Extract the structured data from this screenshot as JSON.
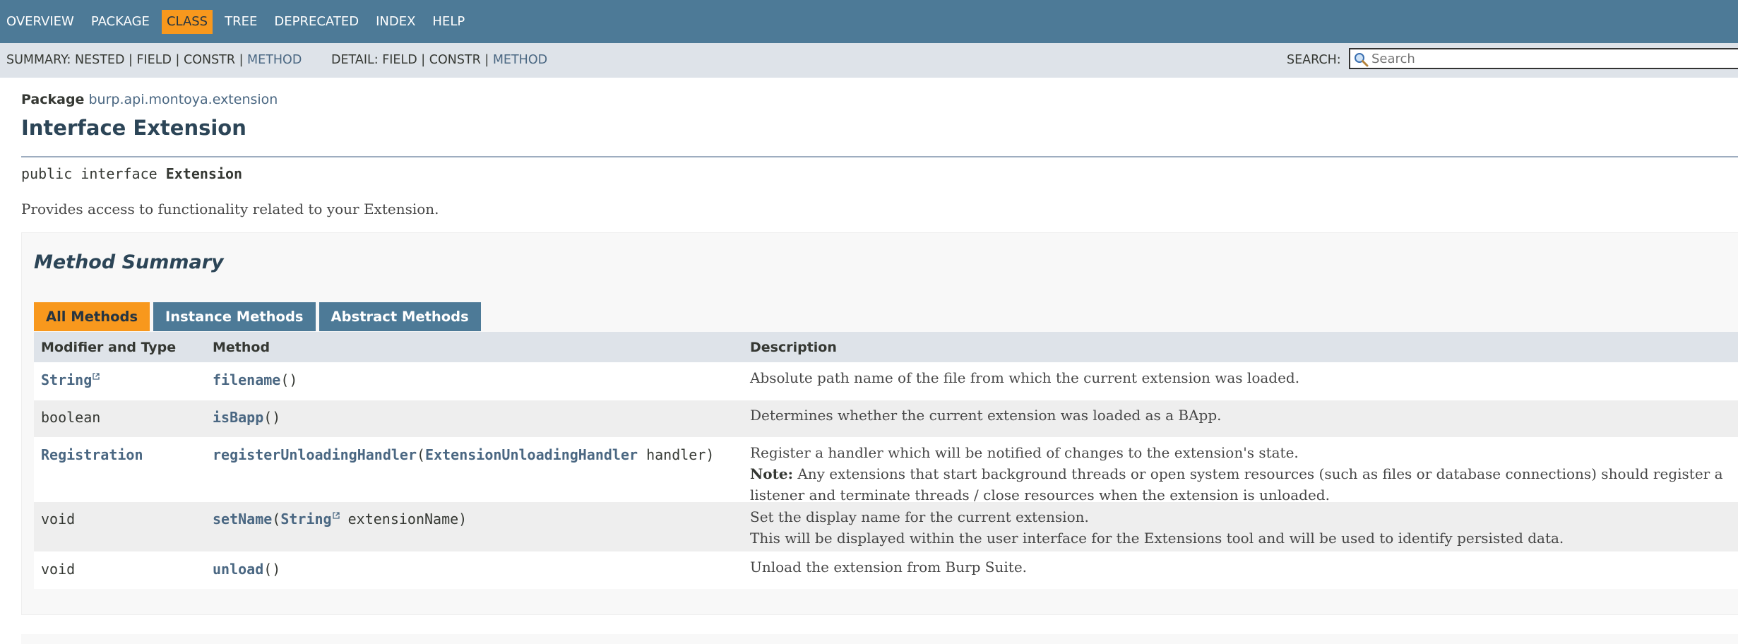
{
  "topnav": {
    "items": [
      {
        "label": "OVERVIEW",
        "active": false
      },
      {
        "label": "PACKAGE",
        "active": false
      },
      {
        "label": "CLASS",
        "active": true
      },
      {
        "label": "TREE",
        "active": false
      },
      {
        "label": "DEPRECATED",
        "active": false
      },
      {
        "label": "INDEX",
        "active": false
      },
      {
        "label": "HELP",
        "active": false
      }
    ]
  },
  "subnav": {
    "summary_prefix": "SUMMARY: NESTED | FIELD | CONSTR | ",
    "summary_method_link": "METHOD",
    "detail_prefix": "DETAIL: FIELD | CONSTR | ",
    "detail_method_link": "METHOD",
    "search_label": "SEARCH:",
    "search_placeholder": "Search",
    "search_icon": "magnifier-icon"
  },
  "header": {
    "package_label": "Package",
    "package_name": "burp.api.montoya.extension",
    "title": "Interface Extension"
  },
  "signature": {
    "prefix": "public interface ",
    "name": "Extension"
  },
  "description": "Provides access to functionality related to your Extension.",
  "method_summary": {
    "heading": "Method Summary",
    "tabs": [
      {
        "label": "All Methods",
        "active": true
      },
      {
        "label": "Instance Methods",
        "active": false
      },
      {
        "label": "Abstract Methods",
        "active": false
      }
    ],
    "columns": [
      "Modifier and Type",
      "Method",
      "Description"
    ],
    "rows": [
      {
        "type": "String",
        "type_link": true,
        "type_external": true,
        "method_name": "filename",
        "method_open": "(",
        "param_type": "",
        "param_external": false,
        "param_name": "",
        "method_close": ")",
        "desc_line1": "Absolute path name of the file from which the current extension was loaded.",
        "desc_note_label": "",
        "desc_line2": ""
      },
      {
        "type": "boolean",
        "type_link": false,
        "type_external": false,
        "method_name": "isBapp",
        "method_open": "(",
        "param_type": "",
        "param_external": false,
        "param_name": "",
        "method_close": ")",
        "desc_line1": "Determines whether the current extension was loaded as a BApp.",
        "desc_note_label": "",
        "desc_line2": ""
      },
      {
        "type": "Registration",
        "type_link": true,
        "type_external": false,
        "method_name": "registerUnloadingHandler",
        "method_open": "(",
        "param_type": "ExtensionUnloadingHandler",
        "param_external": false,
        "param_name": " handler",
        "method_close": ")",
        "desc_line1": "Register a handler which will be notified of changes to the extension's state.",
        "desc_note_label": "Note:",
        "desc_line2": " Any extensions that start background threads or open system resources (such as files or database connections) should register a listener and terminate threads / close resources when the extension is unloaded."
      },
      {
        "type": "void",
        "type_link": false,
        "type_external": false,
        "method_name": "setName",
        "method_open": "(",
        "param_type": "String",
        "param_external": true,
        "param_name": " extensionName",
        "method_close": ")",
        "desc_line1": "Set the display name for the current extension.",
        "desc_note_label": "",
        "desc_line2": "This will be displayed within the user interface for the Extensions tool and will be used to identify persisted data."
      },
      {
        "type": "void",
        "type_link": false,
        "type_external": false,
        "method_name": "unload",
        "method_open": "(",
        "param_type": "",
        "param_external": false,
        "param_name": "",
        "method_close": ")",
        "desc_line1": "Unload the extension from Burp Suite.",
        "desc_note_label": "",
        "desc_line2": ""
      }
    ]
  },
  "colors": {
    "nav_bg": "#4d7a97",
    "active_tab": "#f8981d",
    "subnav_bg": "#dee3e9",
    "link": "#4a6782"
  }
}
